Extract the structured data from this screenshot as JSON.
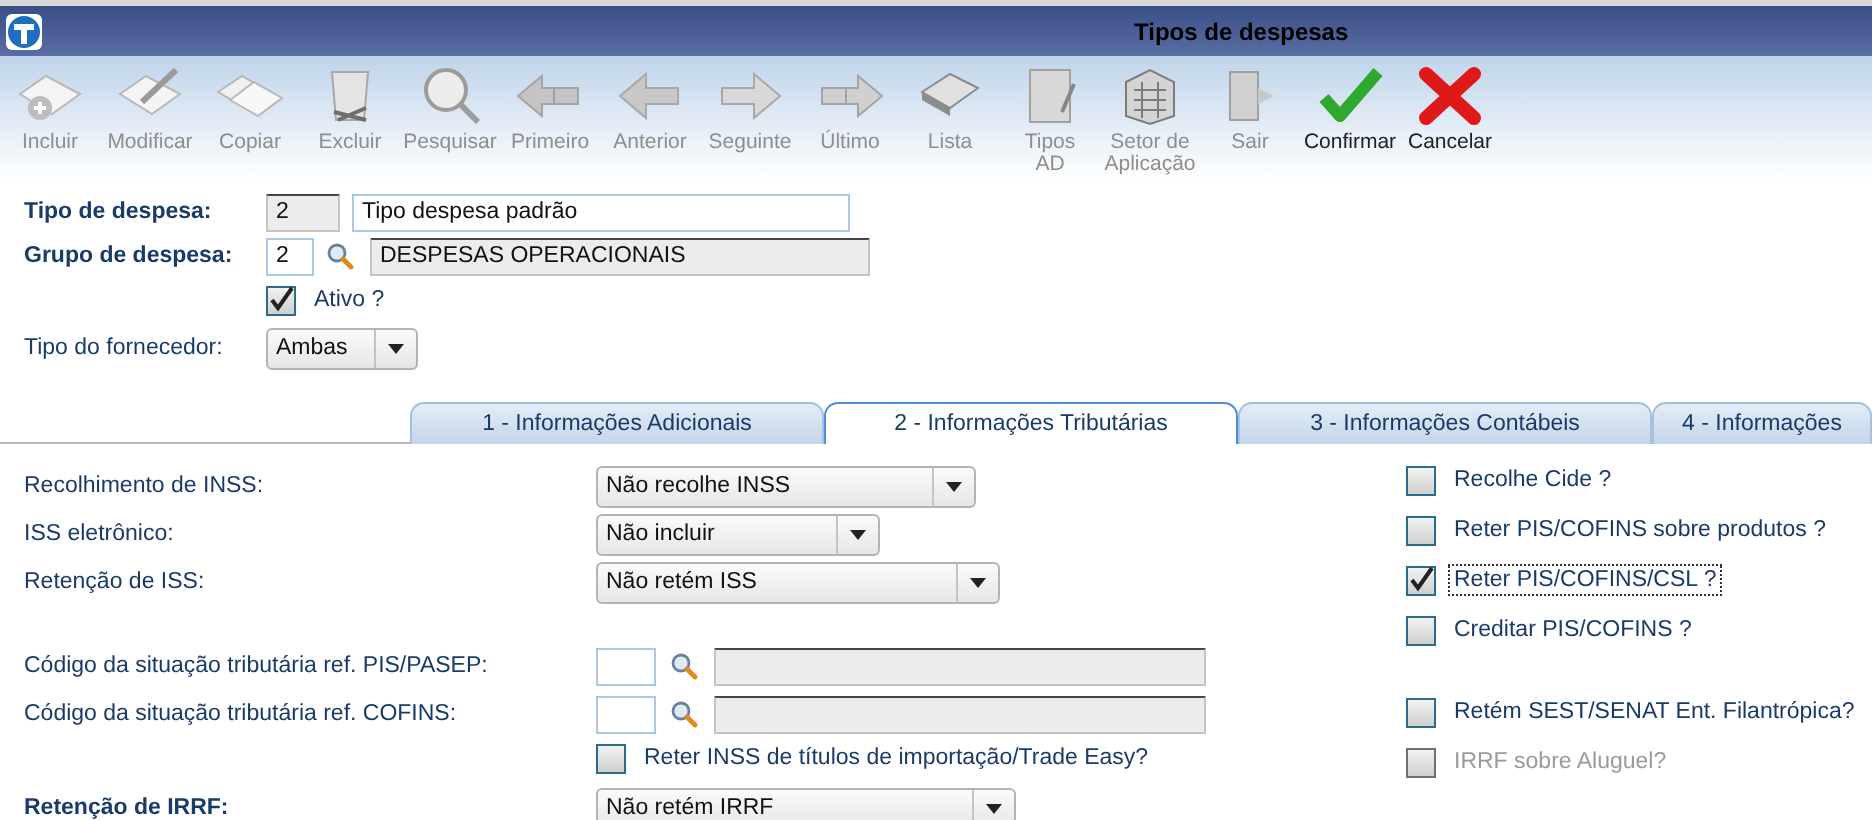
{
  "window": {
    "title": "Tipos de despesas"
  },
  "toolbar": [
    {
      "label": "Incluir",
      "disabled": true
    },
    {
      "label": "Modificar",
      "disabled": true
    },
    {
      "label": "Copiar",
      "disabled": true
    },
    {
      "label": "Excluir",
      "disabled": true
    },
    {
      "label": "Pesquisar",
      "disabled": true
    },
    {
      "label": "Primeiro",
      "disabled": true
    },
    {
      "label": "Anterior",
      "disabled": true
    },
    {
      "label": "Seguinte",
      "disabled": true
    },
    {
      "label": "Último",
      "disabled": true
    },
    {
      "label": "Lista",
      "disabled": true
    },
    {
      "label": "Tipos\nAD",
      "disabled": true
    },
    {
      "label": "Setor de\nAplicação",
      "disabled": true
    },
    {
      "label": "Sair",
      "disabled": true
    },
    {
      "label": "Confirmar",
      "disabled": false
    },
    {
      "label": "Cancelar",
      "disabled": false
    }
  ],
  "header": {
    "expense_type": {
      "label": "Tipo de despesa:",
      "required": true,
      "code": "2",
      "name": "Tipo despesa padrão"
    },
    "expense_group": {
      "label": "Grupo de despesa:",
      "required": true,
      "code": "2",
      "name": "DESPESAS OPERACIONAIS"
    },
    "active": {
      "label": "Ativo ?",
      "checked": true
    },
    "supplier_type": {
      "label": "Tipo do fornecedor:",
      "required": false,
      "value": "Ambas"
    }
  },
  "tabs": [
    {
      "label": "1 - Informações Adicionais",
      "selected": false
    },
    {
      "label": "2 - Informações Tributárias",
      "selected": true
    },
    {
      "label": "3 - Informações Contábeis",
      "selected": false
    },
    {
      "label": "4 - Informações",
      "selected": false
    }
  ],
  "tax_fields": [
    {
      "kind": "select",
      "label": "Recolhimento de INSS:",
      "required": false,
      "value": "Não recolhe INSS"
    },
    {
      "kind": "select",
      "label": "ISS eletrônico:",
      "required": false,
      "value": "Não incluir"
    },
    {
      "kind": "select",
      "label": "Retenção de ISS:",
      "required": false,
      "value": "Não retém ISS"
    },
    {
      "kind": "lookup",
      "label": "Código da situação tributária ref. PIS/PASEP:",
      "required": false
    },
    {
      "kind": "lookup",
      "label": "Código da situação tributária ref. COFINS:",
      "required": false
    },
    {
      "kind": "checkbox",
      "label": "Reter INSS de títulos de importação/Trade Easy?",
      "checked": false
    },
    {
      "kind": "select",
      "label": "Retenção de IRRF:",
      "required": true,
      "value": "Não retém IRRF"
    }
  ],
  "tax_options": [
    {
      "label": "Recolhe Cide ?",
      "checked": false,
      "disabled": false,
      "focused": false
    },
    {
      "label": "Reter PIS/COFINS sobre produtos ?",
      "checked": false,
      "disabled": false,
      "focused": false
    },
    {
      "label": "Reter PIS/COFINS/CSL ?",
      "checked": true,
      "disabled": false,
      "focused": true
    },
    {
      "label": "Creditar PIS/COFINS ?",
      "checked": false,
      "disabled": false,
      "focused": false
    },
    {
      "label": "Retém SEST/SENAT Ent. Filantrópica?",
      "checked": false,
      "disabled": false,
      "focused": false
    },
    {
      "label": "IRRF sobre Aluguel?",
      "checked": false,
      "disabled": true,
      "focused": false
    }
  ]
}
